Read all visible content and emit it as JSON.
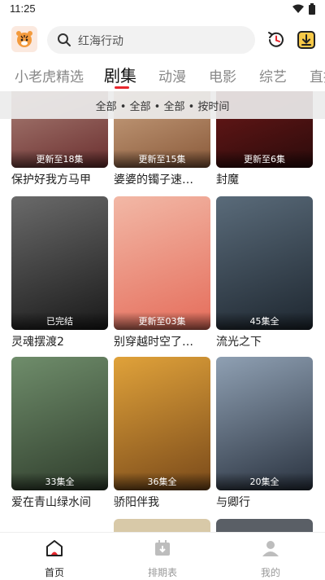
{
  "status": {
    "time": "11:25"
  },
  "search": {
    "placeholder": "红海行动"
  },
  "tabs": [
    {
      "label": "小老虎精选"
    },
    {
      "label": "剧集"
    },
    {
      "label": "动漫"
    },
    {
      "label": "电影"
    },
    {
      "label": "综艺"
    },
    {
      "label": "直播"
    }
  ],
  "filter": {
    "text": "全部 • 全部 • 全部 • 按时间"
  },
  "cards": [
    {
      "title": "保护好我方马甲",
      "badge": "更新至18集",
      "colors": [
        "#c9a89a",
        "#6b2f2f"
      ]
    },
    {
      "title": "婆婆的镯子速…",
      "badge": "更新至15集",
      "colors": [
        "#e9c7a5",
        "#8a5a3a"
      ]
    },
    {
      "title": "封魔",
      "badge": "更新至6集",
      "colors": [
        "#8e1f1f",
        "#2b0b0b"
      ]
    },
    {
      "title": "灵魂摆渡2",
      "badge": "已完结",
      "colors": [
        "#6a6a6a",
        "#1a1a1a"
      ]
    },
    {
      "title": "别穿越时空了…",
      "badge": "更新至03集",
      "colors": [
        "#f2b8a6",
        "#e56d5b"
      ]
    },
    {
      "title": "流光之下",
      "badge": "45集全",
      "colors": [
        "#5a6b7a",
        "#1e2730"
      ]
    },
    {
      "title": "爱在青山绿水间",
      "badge": "33集全",
      "colors": [
        "#6f8d6b",
        "#2f3d2c"
      ]
    },
    {
      "title": "骄阳伴我",
      "badge": "36集全",
      "colors": [
        "#e0a23a",
        "#7a4a1a"
      ]
    },
    {
      "title": "与卿行",
      "badge": "20集全",
      "colors": [
        "#8fa0b3",
        "#2a3340"
      ]
    }
  ],
  "bottom_nav": [
    {
      "label": "首页"
    },
    {
      "label": "排期表"
    },
    {
      "label": "我的"
    }
  ],
  "colors": {
    "accent": "#e8262d",
    "tab_inactive": "#888888"
  }
}
